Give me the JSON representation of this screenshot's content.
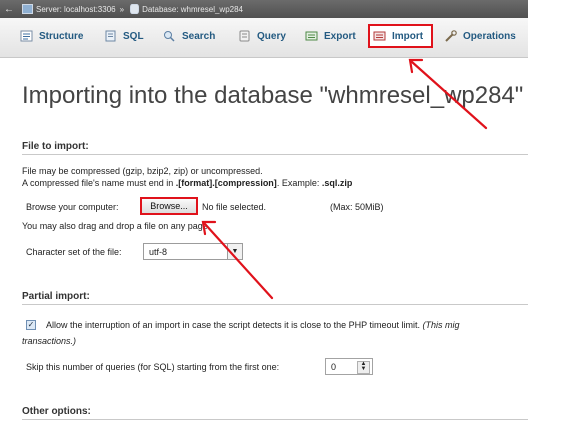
{
  "breadcrumb": {
    "back_arrow": "←",
    "server_label": "Server: localhost:3306",
    "separator": "»",
    "database_label": "Database: whmresel_wp284"
  },
  "tabs": [
    {
      "label": "Structure",
      "icon": "structure-icon"
    },
    {
      "label": "SQL",
      "icon": "sql-icon"
    },
    {
      "label": "Search",
      "icon": "search-icon"
    },
    {
      "label": "Query",
      "icon": "query-icon"
    },
    {
      "label": "Export",
      "icon": "export-icon"
    },
    {
      "label": "Import",
      "icon": "import-icon",
      "active": true
    },
    {
      "label": "Operations",
      "icon": "operations-icon"
    }
  ],
  "page_title": "Importing into the database \"whmresel_wp284\"",
  "file_section": {
    "heading": "File to import:",
    "compression_line": "File may be compressed (gzip, bzip2, zip) or uncompressed.",
    "name_line_prefix": "A compressed file's name must end in ",
    "name_line_format": ".[format].[compression]",
    "name_line_mid": ". Example: ",
    "name_line_example": ".sql.zip",
    "browse_label": "Browse your computer:",
    "browse_button": "Browse...",
    "no_file": "No file selected.",
    "max_size": "(Max: 50MiB)",
    "drag_drop": "You may also drag and drop a file on any page.",
    "charset_label": "Character set of the file:",
    "charset_value": "utf-8"
  },
  "partial_section": {
    "heading": "Partial import:",
    "allow_interrupt_checked": true,
    "allow_interrupt_text": "Allow the interruption of an import in case the script detects it is close to the PHP timeout limit.",
    "allow_interrupt_note": "(This mig",
    "allow_interrupt_note_line2": "transactions.)",
    "skip_label": "Skip this number of queries (for SQL) starting from the first one:",
    "skip_value": "0"
  },
  "other_section": {
    "heading": "Other options:"
  },
  "annotation_color": "#e0121b"
}
